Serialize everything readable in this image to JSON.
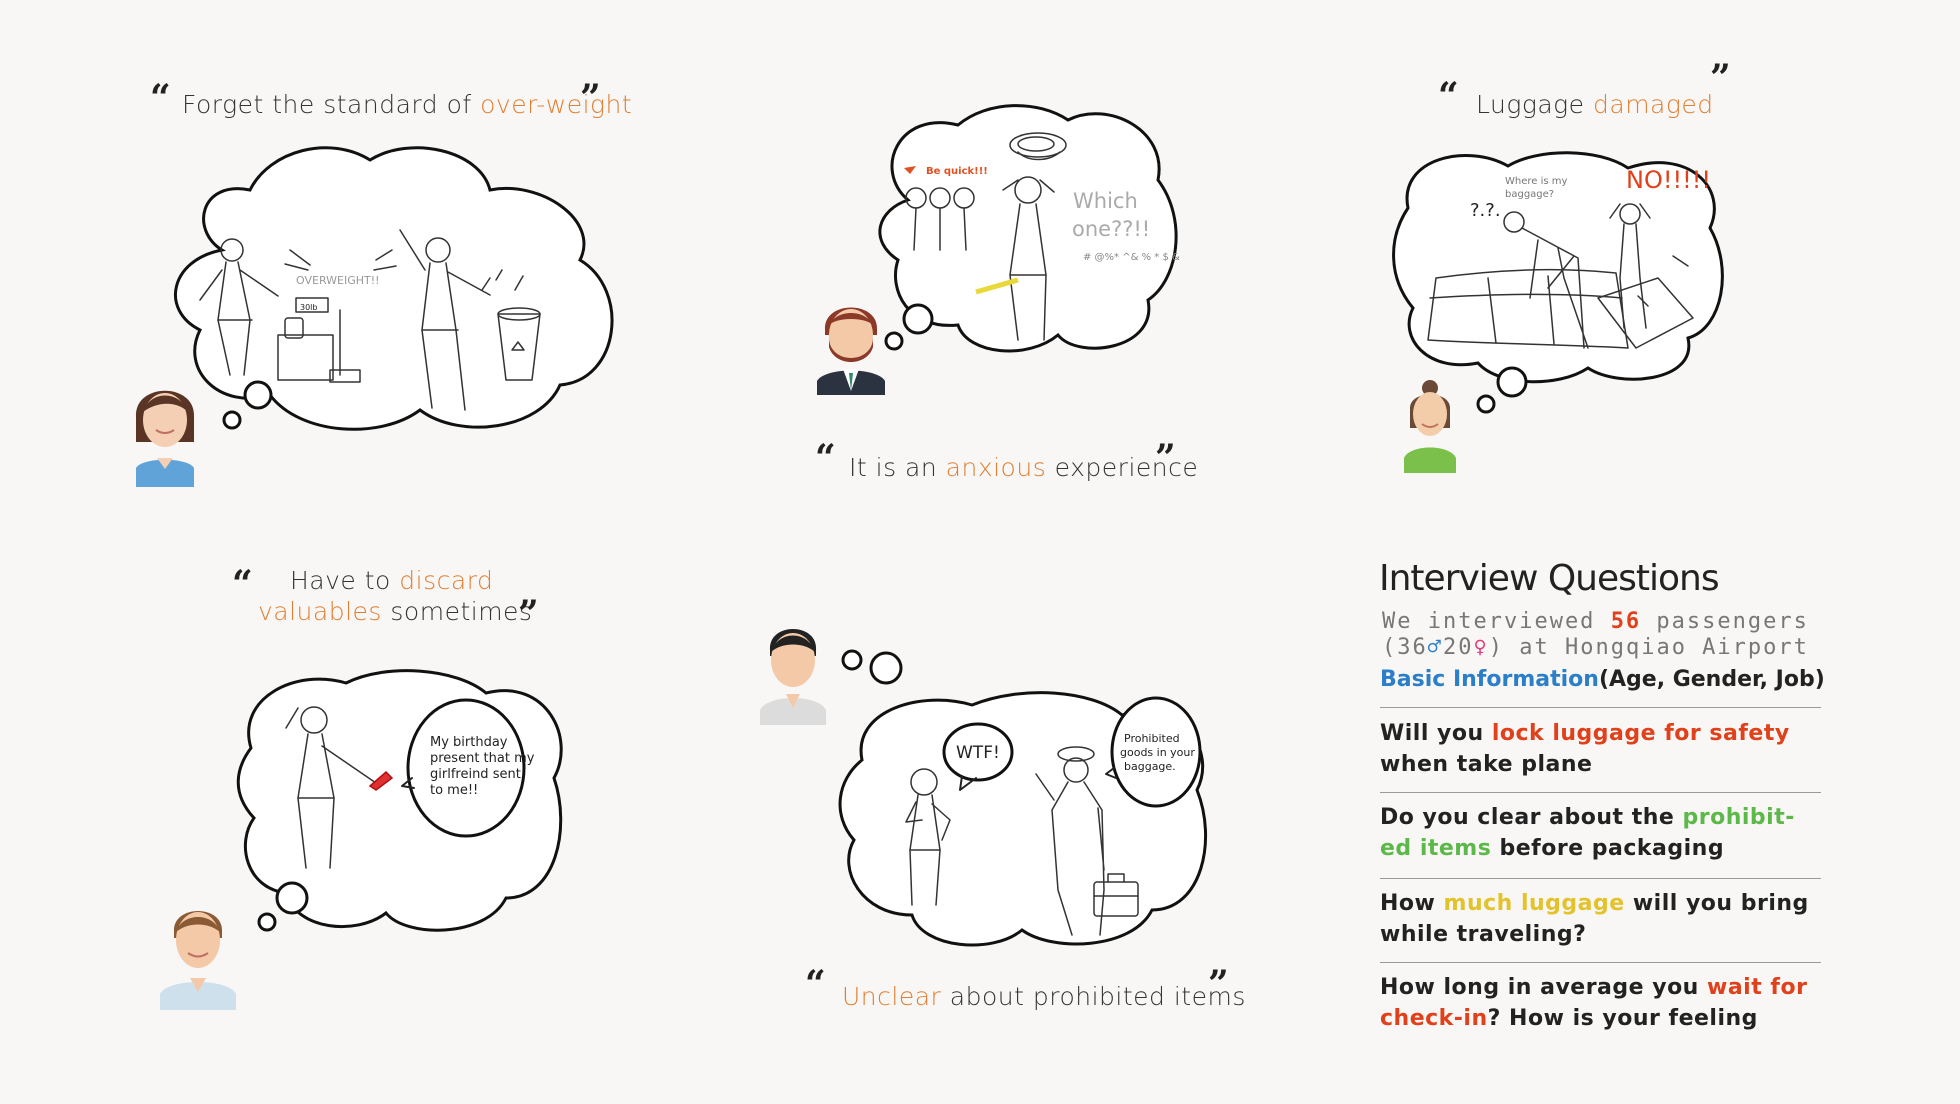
{
  "quotes": {
    "q1": {
      "pre": "Forget the standard of ",
      "hl": "over-weight",
      "post": ""
    },
    "q2": {
      "pre": "It is an ",
      "hl": "anxious",
      "post": " experience"
    },
    "q3": {
      "pre": "Luggage ",
      "hl": "damaged",
      "post": ""
    },
    "q4": {
      "line1_pre": "Have to ",
      "line1_hl": "discard",
      "line2_hl": "valuables",
      "line2_post": " sometimes"
    },
    "q5": {
      "hl": "Unclear",
      "post": " about prohibited items"
    }
  },
  "sketch_text": {
    "overweight": "OVERWEIGHT!!",
    "scale": "30lb",
    "be_quick": "Be quick!!!",
    "which_one_1": "Which",
    "which_one_2": "one??!!",
    "symbols": "# @%* ^& % * $ &",
    "where_1": "Where is my",
    "where_2": "baggage?",
    "question_marks": "?.?.",
    "no": "NO!!!!!",
    "birthday": [
      "My birthday",
      "present that my",
      "girlfreind sent",
      "to me!!"
    ],
    "wtf": "WTF!",
    "prohibited": [
      "Prohibited",
      "goods in your",
      "baggage."
    ]
  },
  "interview": {
    "title": "Interview Questions",
    "sub1_pre": "We interviewed ",
    "sub1_num": "56",
    "sub1_post": " passengers",
    "sub2_pre": "(36",
    "sub2_male": "♂",
    "sub2_mid": "20",
    "sub2_female": "♀",
    "sub2_post": ") at Hongqiao Airport",
    "basic_hl": "Basic Information",
    "basic_post": "(Age, Gender, Job)",
    "q1_pre": "Will you ",
    "q1_hl": "lock luggage for safety",
    "q1_line2": "when take plane",
    "q2_pre": "Do you clear about the ",
    "q2_hl1": "prohibit-",
    "q2_hl2": "ed items",
    "q2_post": " before packaging",
    "q3_pre": "How ",
    "q3_hl": "much luggage",
    "q3_post": " will you bring",
    "q3_line2": "while traveling?",
    "q4_pre": "How long in average you ",
    "q4_hl1": "wait for",
    "q4_hl2": "check-in",
    "q4_post": "?  How is your feeling"
  },
  "colors": {
    "quote_highlight": "#e07f33",
    "red": "#e0401a",
    "blue": "#2b7fc8",
    "green": "#5db84a",
    "yellow": "#e3c22a"
  }
}
